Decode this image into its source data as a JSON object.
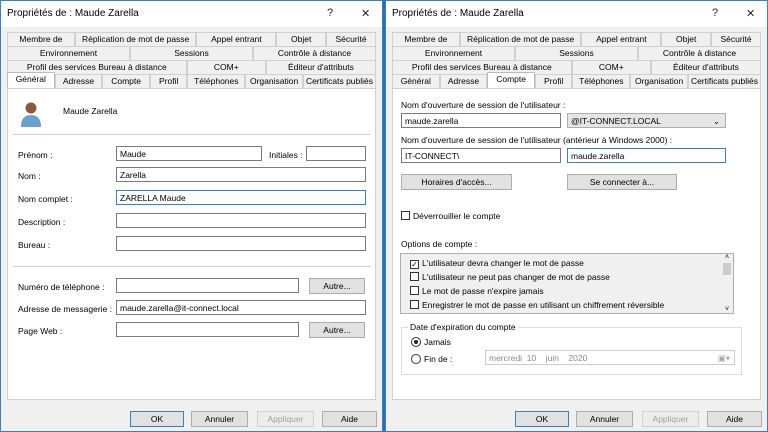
{
  "dialog_title": "Propriétés de : Maude Zarella",
  "help": "?",
  "close": "✕",
  "tabs": {
    "row1": [
      "Membre de",
      "Réplication de mot de passe",
      "Appel entrant",
      "Objet",
      "Sécurité"
    ],
    "row2": [
      "Environnement",
      "Sessions",
      "Contrôle à distance"
    ],
    "row3": [
      "Profil des services Bureau à distance",
      "COM+",
      "Éditeur d'attributs"
    ],
    "row4": [
      "Général",
      "Adresse",
      "Compte",
      "Profil",
      "Téléphones",
      "Organisation",
      "Certificats publiés"
    ]
  },
  "general": {
    "display_name": "Maude Zarella",
    "prenom_label": "Prénom :",
    "prenom": "Maude",
    "initiales_label": "Initiales :",
    "initiales": "",
    "nom_label": "Nom :",
    "nom": "Zarella",
    "nom_complet_label": "Nom complet :",
    "nom_complet": "ZARELLA Maude",
    "description_label": "Description :",
    "description": "",
    "bureau_label": "Bureau :",
    "bureau": "",
    "tel_label": "Numéro de téléphone :",
    "tel": "",
    "mail_label": "Adresse de messagerie :",
    "mail": "maude.zarella@it-connect.local",
    "web_label": "Page Web :",
    "web": "",
    "autre": "Autre..."
  },
  "compte": {
    "logon_label": "Nom d'ouverture de session de l'utilisateur :",
    "logon": "maude.zarella",
    "domain": "@IT-CONNECT.LOCAL",
    "pre2000_label": "Nom d'ouverture de session de l'utilisateur (antérieur à Windows 2000) :",
    "pre2000_domain": "IT-CONNECT\\",
    "pre2000_user": "maude.zarella",
    "hours": "Horaires d'accès...",
    "logon_to": "Se connecter à...",
    "unlock": "Déverrouiller le compte",
    "options_label": "Options de compte :",
    "options": [
      {
        "label": "L'utilisateur devra changer le mot de passe",
        "checked": true
      },
      {
        "label": "L'utilisateur ne peut pas changer de mot de passe",
        "checked": false
      },
      {
        "label": "Le mot de passe n'expire jamais",
        "checked": false
      },
      {
        "label": "Enregistrer le mot de passe en utilisant un chiffrement réversible",
        "checked": false
      }
    ],
    "expiry_label": "Date d'expiration du compte",
    "never": "Jamais",
    "end_of": "Fin de :",
    "date_day": "mercredi",
    "date_num": "10",
    "date_month": "juin",
    "date_year": "2020"
  },
  "buttons": {
    "ok": "OK",
    "cancel": "Annuler",
    "apply": "Appliquer",
    "help": "Aide"
  }
}
